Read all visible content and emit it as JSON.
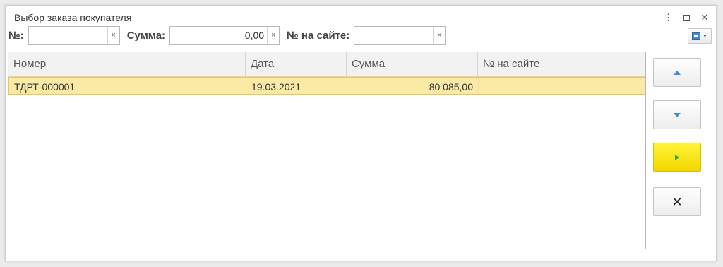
{
  "window": {
    "title": "Выбор заказа покупателя",
    "controls": {
      "more": "⋮",
      "close": "✕"
    }
  },
  "filters": {
    "number": {
      "label": "№:",
      "value": ""
    },
    "sum": {
      "label": "Сумма:",
      "value": "0,00"
    },
    "site_number": {
      "label": "№ на сайте:",
      "value": ""
    },
    "clear_glyph": "×"
  },
  "grid": {
    "columns": [
      "Номер",
      "Дата",
      "Сумма",
      "№ на сайте"
    ],
    "rows": [
      {
        "number": "ТДРТ-000001",
        "date": "19.03.2021",
        "sum": "80 085,00",
        "site_number": ""
      }
    ]
  },
  "side_buttons": {
    "close_glyph": "✕"
  },
  "colors": {
    "selected_row": "#fbe9a6",
    "selected_border": "#f0c64a",
    "select_button": "#f2d700",
    "arrow_blue": "#3e8fd6",
    "play_green": "#2fa92f"
  },
  "icons": [
    "more-vert-icon",
    "maximize-icon",
    "close-icon",
    "settings-icon",
    "arrow-up-icon",
    "arrow-down-icon",
    "play-icon",
    "close-x-icon"
  ]
}
